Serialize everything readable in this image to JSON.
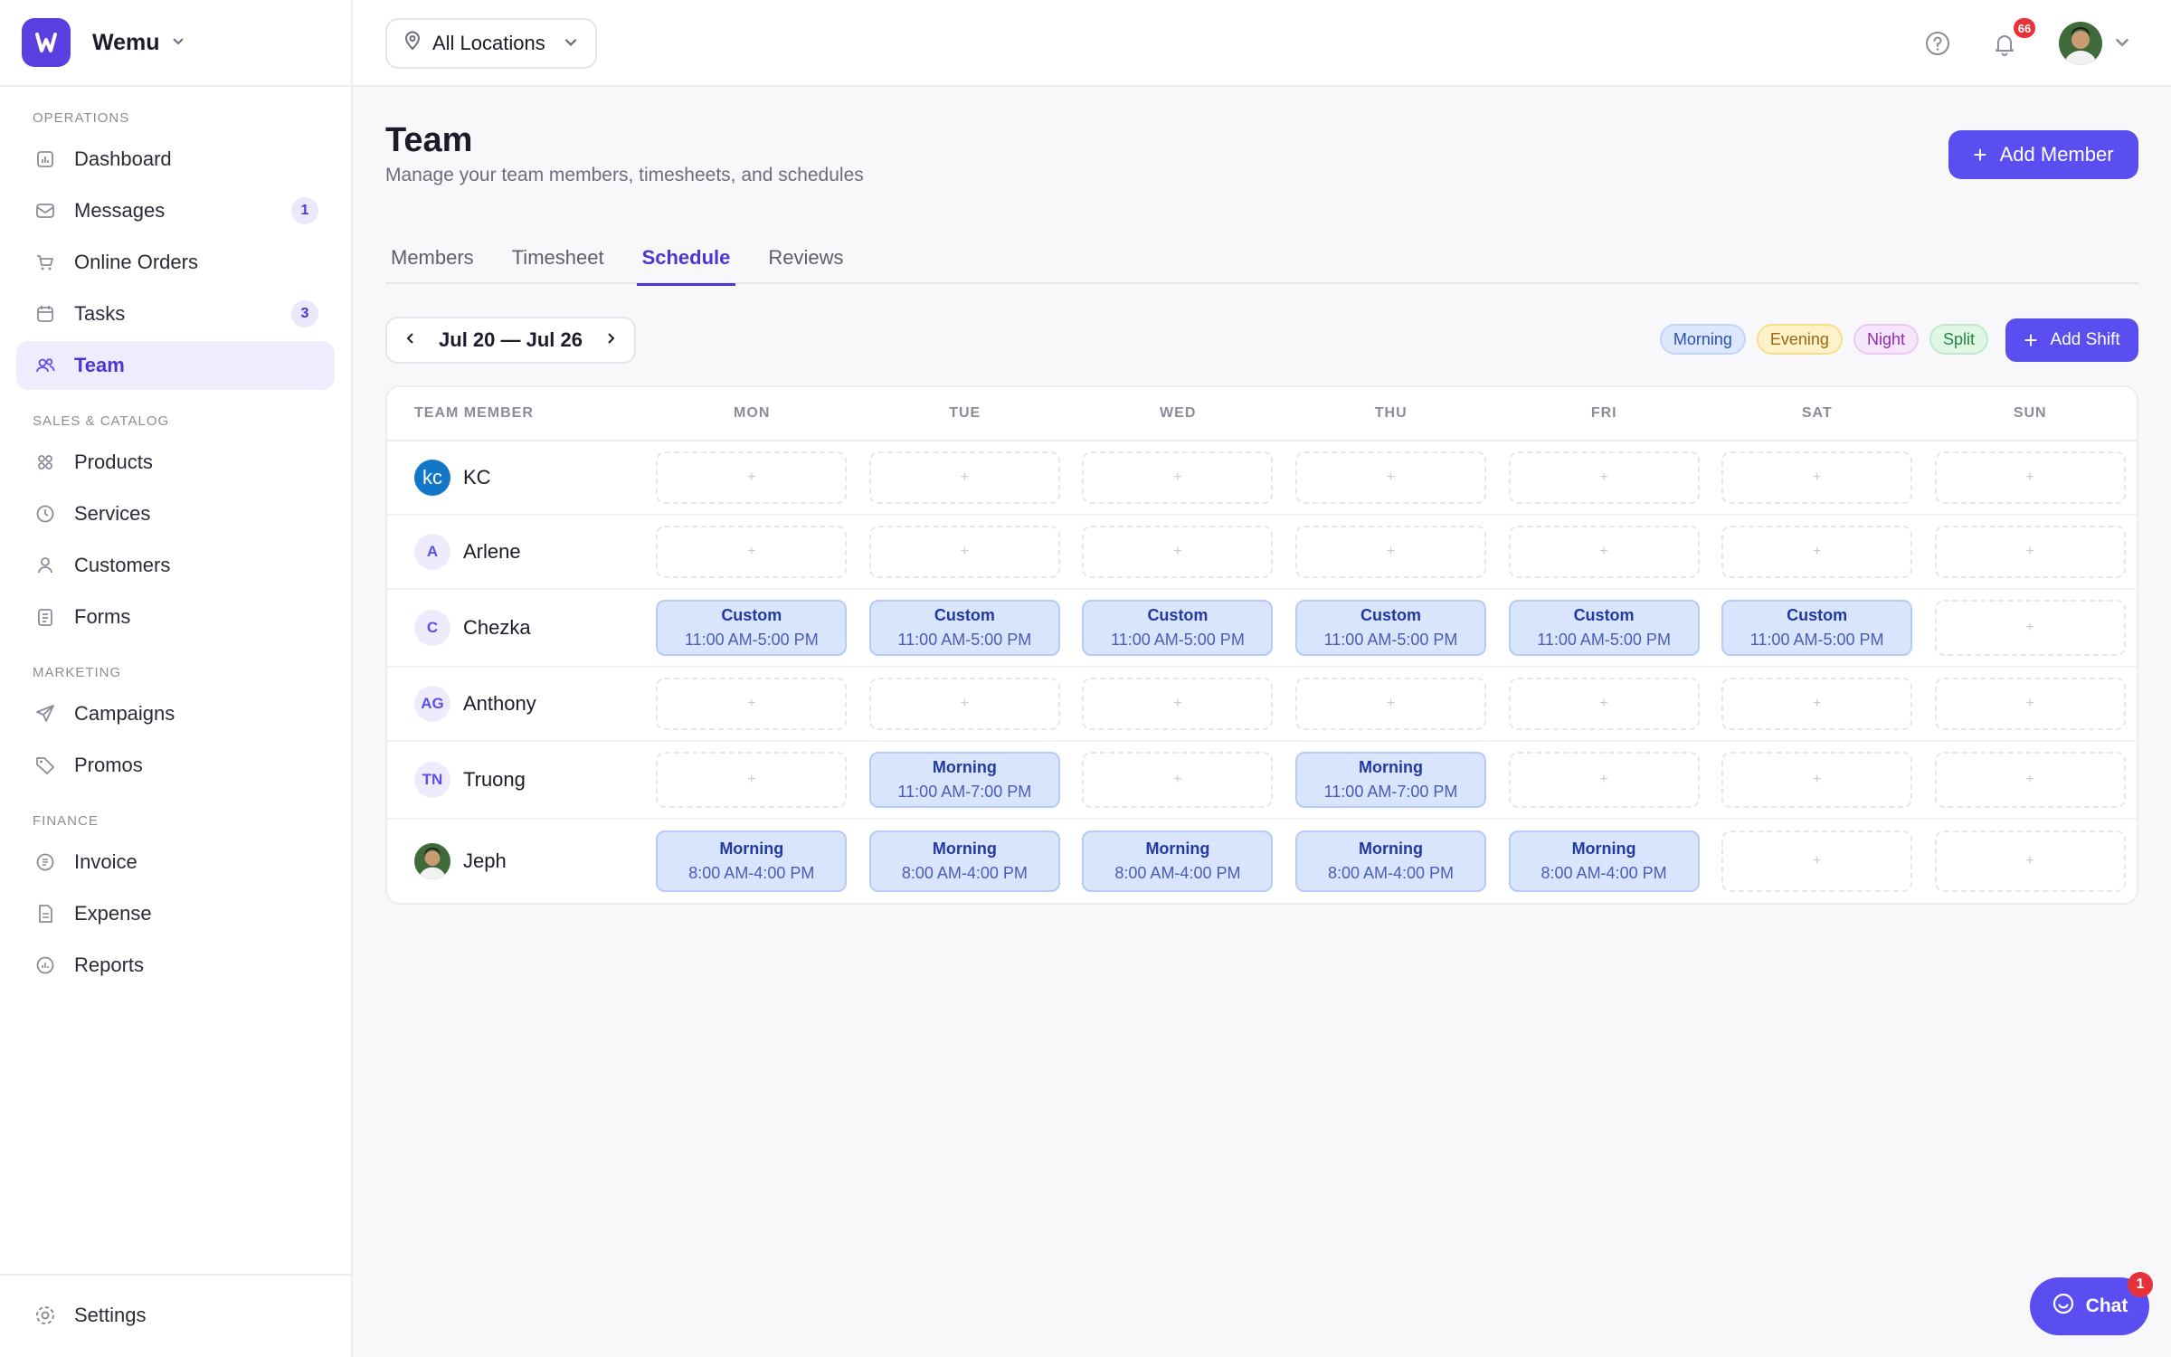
{
  "brand": {
    "name": "Wemu"
  },
  "sidebar": {
    "sections": [
      {
        "title": "OPERATIONS",
        "items": [
          {
            "label": "Dashboard",
            "icon": "chart-icon"
          },
          {
            "label": "Messages",
            "icon": "inbox-icon",
            "badge": "1"
          },
          {
            "label": "Online Orders",
            "icon": "cart-icon"
          },
          {
            "label": "Tasks",
            "icon": "calendar-icon",
            "badge": "3"
          },
          {
            "label": "Team",
            "icon": "users-icon",
            "active": true
          }
        ]
      },
      {
        "title": "SALES & CATALOG",
        "items": [
          {
            "label": "Products",
            "icon": "grid-icon"
          },
          {
            "label": "Services",
            "icon": "clock-icon"
          },
          {
            "label": "Customers",
            "icon": "user-icon"
          },
          {
            "label": "Forms",
            "icon": "clipboard-icon"
          }
        ]
      },
      {
        "title": "MARKETING",
        "items": [
          {
            "label": "Campaigns",
            "icon": "send-icon"
          },
          {
            "label": "Promos",
            "icon": "tag-icon"
          }
        ]
      },
      {
        "title": "FINANCE",
        "items": [
          {
            "label": "Invoice",
            "icon": "invoice-icon"
          },
          {
            "label": "Expense",
            "icon": "expense-icon"
          },
          {
            "label": "Reports",
            "icon": "reports-icon"
          }
        ]
      }
    ],
    "settings_label": "Settings"
  },
  "topbar": {
    "location": "All Locations",
    "notifications_count": "66"
  },
  "page": {
    "title": "Team",
    "subtitle": "Manage your team members, timesheets, and schedules",
    "add_member_label": "Add Member"
  },
  "tabs": [
    "Members",
    "Timesheet",
    "Schedule",
    "Reviews"
  ],
  "active_tab": "Schedule",
  "schedule": {
    "week_range": "Jul 20 — Jul 26",
    "legend": [
      "Morning",
      "Evening",
      "Night",
      "Split"
    ],
    "add_shift_label": "Add Shift",
    "header_member": "TEAM MEMBER",
    "days": [
      "MON",
      "TUE",
      "WED",
      "THU",
      "FRI",
      "SAT",
      "SUN"
    ],
    "empty_symbol": "+",
    "rows": [
      {
        "initials": "kc",
        "name": "KC",
        "avatar": "blue",
        "shifts": [
          null,
          null,
          null,
          null,
          null,
          null,
          null
        ]
      },
      {
        "initials": "A",
        "name": "Arlene",
        "avatar": "initials",
        "shifts": [
          null,
          null,
          null,
          null,
          null,
          null,
          null
        ]
      },
      {
        "initials": "C",
        "name": "Chezka",
        "avatar": "initials",
        "shifts": [
          {
            "type": "Custom",
            "time": "11:00 AM-5:00 PM"
          },
          {
            "type": "Custom",
            "time": "11:00 AM-5:00 PM"
          },
          {
            "type": "Custom",
            "time": "11:00 AM-5:00 PM"
          },
          {
            "type": "Custom",
            "time": "11:00 AM-5:00 PM"
          },
          {
            "type": "Custom",
            "time": "11:00 AM-5:00 PM"
          },
          {
            "type": "Custom",
            "time": "11:00 AM-5:00 PM"
          },
          null
        ]
      },
      {
        "initials": "AG",
        "name": "Anthony",
        "avatar": "initials",
        "shifts": [
          null,
          null,
          null,
          null,
          null,
          null,
          null
        ]
      },
      {
        "initials": "TN",
        "name": "Truong",
        "avatar": "initials",
        "shifts": [
          null,
          {
            "type": "Morning",
            "time": "11:00 AM-7:00 PM"
          },
          null,
          {
            "type": "Morning",
            "time": "11:00 AM-7:00 PM"
          },
          null,
          null,
          null
        ]
      },
      {
        "initials": "",
        "name": "Jeph",
        "avatar": "photo",
        "shifts": [
          {
            "type": "Morning",
            "time": "8:00 AM-4:00 PM"
          },
          {
            "type": "Morning",
            "time": "8:00 AM-4:00 PM"
          },
          {
            "type": "Morning",
            "time": "8:00 AM-4:00 PM"
          },
          {
            "type": "Morning",
            "time": "8:00 AM-4:00 PM"
          },
          {
            "type": "Morning",
            "time": "8:00 AM-4:00 PM"
          },
          null,
          null
        ]
      }
    ]
  },
  "chat": {
    "label": "Chat",
    "badge": "1"
  },
  "colors": {
    "accent": "#5b4ef0",
    "active_nav_bg": "#efecfd",
    "shift_bg": "#d9e5fd",
    "badge_red": "#e5323b"
  }
}
